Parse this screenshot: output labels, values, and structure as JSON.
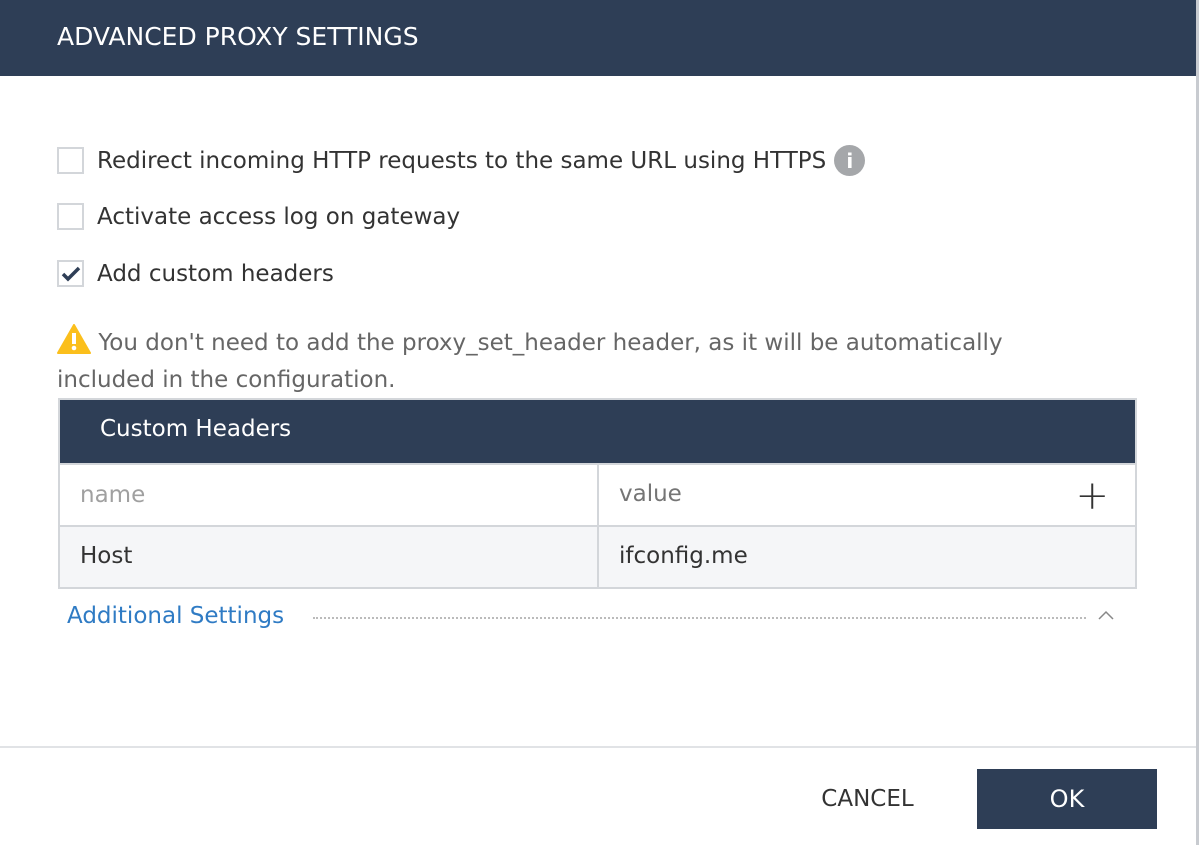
{
  "dialog": {
    "title": "ADVANCED PROXY SETTINGS"
  },
  "options": [
    {
      "label": "Redirect incoming HTTP requests to the same URL using HTTPS",
      "checked": false
    },
    {
      "label": "Activate access log on gateway",
      "checked": false
    },
    {
      "label": "Add custom headers",
      "checked": true
    }
  ],
  "info_icon": "i",
  "warning": "You don't need to add the proxy_set_header header, as it will be automatically included in the configuration.",
  "table": {
    "title": "Custom Headers",
    "name_placeholder": "name",
    "value_placeholder": "value",
    "add_icon": "+",
    "rows": [
      {
        "name": "Host",
        "value": "ifconfig.me"
      }
    ]
  },
  "additional_settings": "Additional Settings",
  "footer": {
    "cancel": "CANCEL",
    "ok": "OK"
  },
  "colors": {
    "primary": "#2e3e56",
    "link": "#2f7bc4",
    "warning": "#fbbf1c"
  }
}
